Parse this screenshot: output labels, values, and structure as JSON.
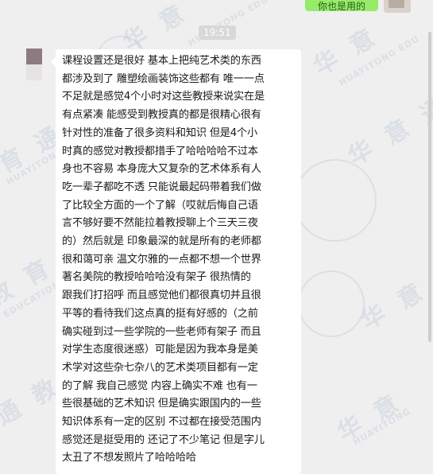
{
  "chat": {
    "timestamp": "19:51",
    "top_message_fragment": "你也是用的",
    "message_lines": [
      "课程设置还是很好 基本上把纯艺术类的东西",
      "都涉及到了 雕塑绘画装饰这些都有 唯一一点",
      "不足就是感觉4个小时对这些教授来说实在是",
      "有点紧凑 能感受到教授真的都是很精心很有",
      "针对性的准备了很多资料和知识 但是4个小",
      "时真的感觉对教授都措手了哈哈哈哈不过本",
      "身也不容易 本身庞大又复杂的艺术体系有人",
      "吃一辈子都吃不透 只能说最起码带着我们做",
      "了比较全方面的一个了解（哎就后悔自己语",
      "言不够好要不然能拉着教授聊上个三天三夜",
      "的）然后就是 印象最深的就是所有的老师都",
      "很和蔼可亲 温文尔雅的一点都不想一个世界",
      "著名美院的教授哈哈哈没有架子 很热情的",
      "跟我们打招呼 而且感觉他们都很真切并且很",
      "平等的看待我们这点真的挺有好感的（之前",
      "确实碰到过一些学院的一些老师有架子 而且",
      "对学生态度很迷惑）可能是因为我本身是美",
      "术学对这些杂七杂八的艺术类项目都有一定",
      "的了解 我自己感觉 内容上确实不难 也有一",
      "些很基础的艺术知识 但是确实跟国内的一些",
      "知识体系有一定的区别 不过都在接受范围内",
      "感觉还是挺受用的 还记了不少笔记 但是字儿",
      "太丑了不想发照片了哈哈哈哈"
    ]
  },
  "watermark": {
    "brand_cn": "华 意 通 教 育",
    "brand_en": "HUAYITONG EDUCATION"
  },
  "colors": {
    "background": "#efefef",
    "bubble": "#ffffff",
    "sent_bubble": "#95ec69",
    "watermark": "#96aac8"
  }
}
